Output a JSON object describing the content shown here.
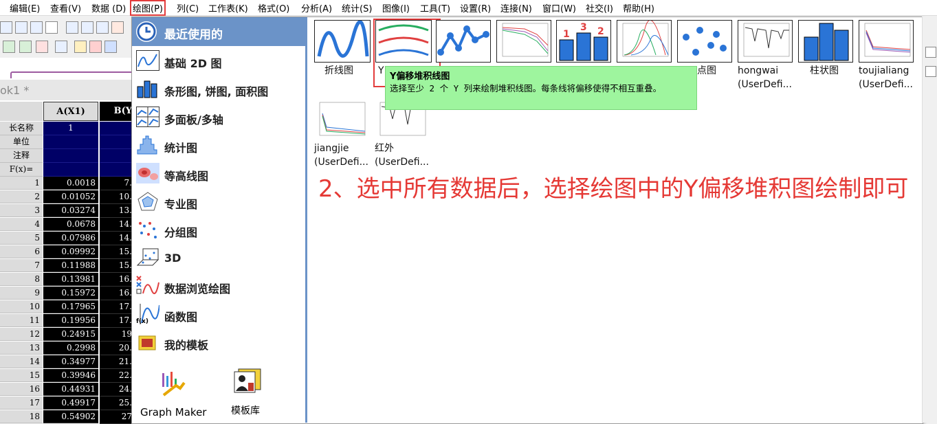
{
  "menu": [
    "编辑(E)",
    "查看(V)",
    "数据 (D)",
    "绘图(P)",
    "列(C)",
    "工作表(K)",
    "格式(O)",
    "分析(A)",
    "统计(S)",
    "图像(I)",
    "工具(T)",
    "设置(R)",
    "连接(N)",
    "窗口(W)",
    "社交(I)",
    "帮助(H)"
  ],
  "worksheet": {
    "title": "ok1 *",
    "col_a": "A(X1)",
    "col_b": "B(Y",
    "meta": [
      "长名称",
      "单位",
      "注释",
      "F(x)="
    ],
    "meta_a_first": "1",
    "rows": [
      {
        "n": "1",
        "a": "0.0018",
        "b": "7."
      },
      {
        "n": "2",
        "a": "0.01052",
        "b": "10."
      },
      {
        "n": "3",
        "a": "0.03274",
        "b": "13."
      },
      {
        "n": "4",
        "a": "0.0678",
        "b": "14."
      },
      {
        "n": "5",
        "a": "0.07986",
        "b": "14."
      },
      {
        "n": "6",
        "a": "0.09992",
        "b": "15."
      },
      {
        "n": "7",
        "a": "0.11988",
        "b": "15."
      },
      {
        "n": "8",
        "a": "0.13981",
        "b": "16."
      },
      {
        "n": "9",
        "a": "0.15972",
        "b": "16."
      },
      {
        "n": "10",
        "a": "0.17965",
        "b": "17."
      },
      {
        "n": "11",
        "a": "0.19956",
        "b": "17."
      },
      {
        "n": "12",
        "a": "0.24915",
        "b": "19"
      },
      {
        "n": "13",
        "a": "0.2998",
        "b": "20."
      },
      {
        "n": "14",
        "a": "0.34977",
        "b": "21."
      },
      {
        "n": "15",
        "a": "0.39946",
        "b": "22."
      },
      {
        "n": "16",
        "a": "0.44931",
        "b": "24."
      },
      {
        "n": "17",
        "a": "0.49917",
        "b": "25."
      },
      {
        "n": "18",
        "a": "0.54902",
        "b": "27"
      }
    ]
  },
  "categories": {
    "header": "最近使用的",
    "items": [
      "基础 2D 图",
      "条形图, 饼图, 面积图",
      "多面板/多轴",
      "统计图",
      "等高线图",
      "专业图",
      "分组图",
      "3D",
      "数据浏览绘图",
      "函数图",
      "我的模板"
    ],
    "graph_maker": "Graph Maker",
    "template_lib": "模板库"
  },
  "thumbnails": {
    "line": "折线图",
    "yoffset_partial": "Y",
    "scatter_partial": "点图",
    "hongwai_1": "hongwai",
    "hongwai_2": "(UserDefi...",
    "bar": "柱状图",
    "toujia_1": "toujialiang",
    "toujia_2": "(UserDefi...",
    "jiangjie_1": "jiangjie",
    "jiangjie_2": "(UserDefi...",
    "hongwai2_1": "红外",
    "hongwai2_2": "(UserDefi..."
  },
  "tooltip": {
    "title": "Y偏移堆积线图",
    "body": "选择至少 2 个 Y 列来绘制堆积线图。每条线将偏移使得不相互重叠。"
  },
  "note": "2、选中所有数据后，选择绘图中的Y偏移堆积图绘制即可",
  "colors": {
    "accent": "#6b93c8",
    "highlight": "#e23b3b",
    "tooltip": "#9ef59e",
    "note": "#e53935"
  }
}
